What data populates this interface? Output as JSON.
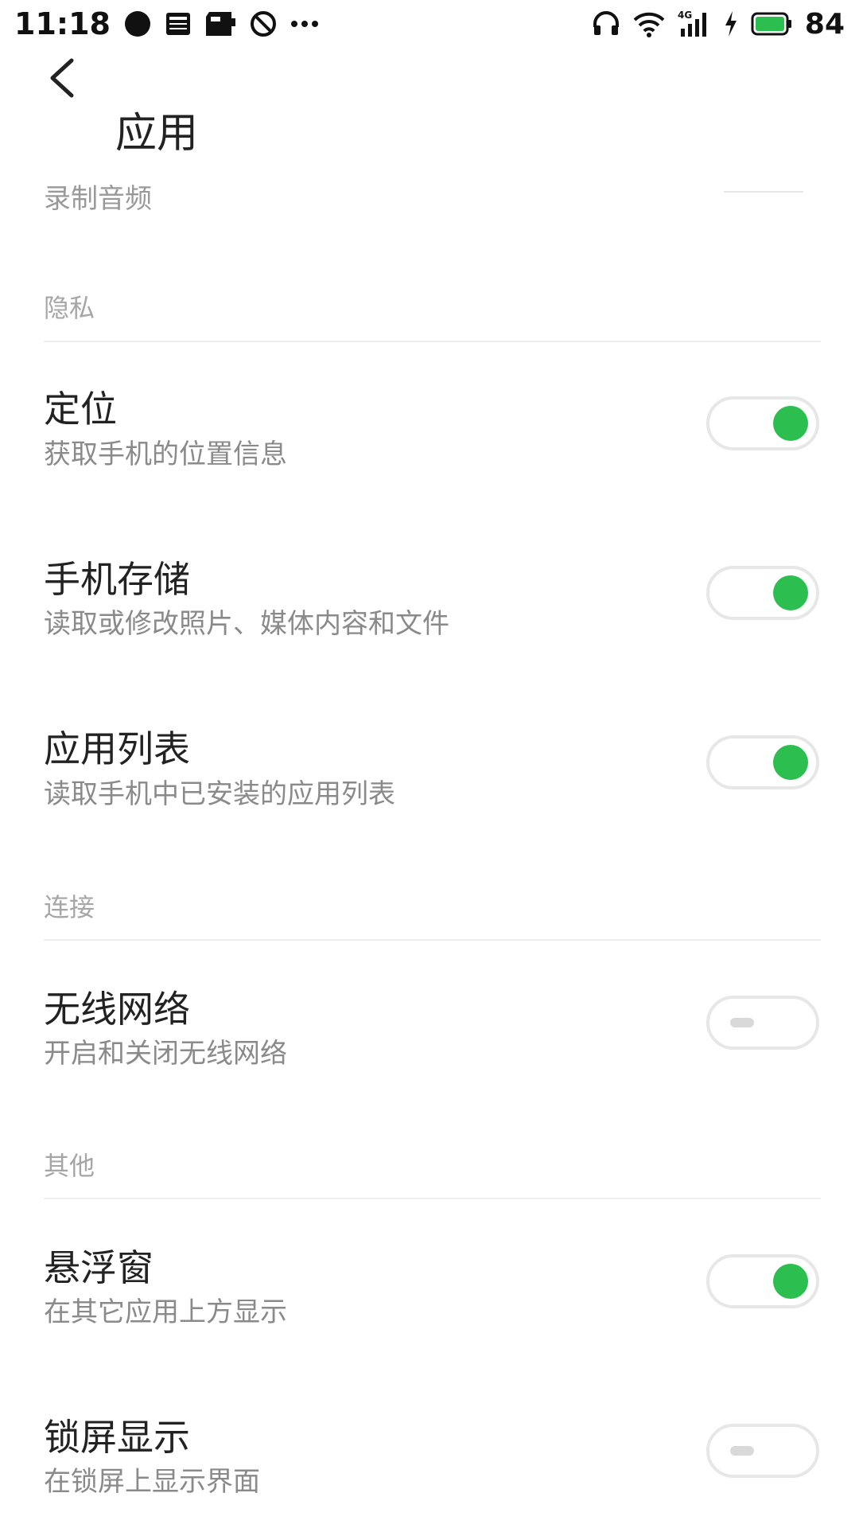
{
  "status_bar": {
    "time": "11:18",
    "network": "4G",
    "battery_percent": "84",
    "icons": [
      "chat-bubble-icon",
      "news-icon",
      "sd-card-icon",
      "no-disturb-icon",
      "more-icon",
      "headphones-icon",
      "wifi-icon",
      "signal-icon",
      "charging-icon",
      "battery-icon"
    ]
  },
  "header": {
    "title": "应用"
  },
  "peek": {
    "label": "录制音频"
  },
  "sections": {
    "privacy": {
      "label": "隐私"
    },
    "connection": {
      "label": "连接"
    },
    "other": {
      "label": "其他"
    }
  },
  "settings": [
    {
      "title": "定位",
      "desc": "获取手机的位置信息",
      "enabled": true
    },
    {
      "title": "手机存储",
      "desc": "读取或修改照片、媒体内容和文件",
      "enabled": true
    },
    {
      "title": "应用列表",
      "desc": "读取手机中已安装的应用列表",
      "enabled": true
    },
    {
      "title": "无线网络",
      "desc": "开启和关闭无线网络",
      "enabled": false
    },
    {
      "title": "悬浮窗",
      "desc": "在其它应用上方显示",
      "enabled": true
    },
    {
      "title": "锁屏显示",
      "desc": "在锁屏上显示界面",
      "enabled": false
    }
  ],
  "colors": {
    "accent": "#2cbf4f",
    "toggle_border": "#e7e7e7",
    "section_text": "#a6a6a6"
  }
}
